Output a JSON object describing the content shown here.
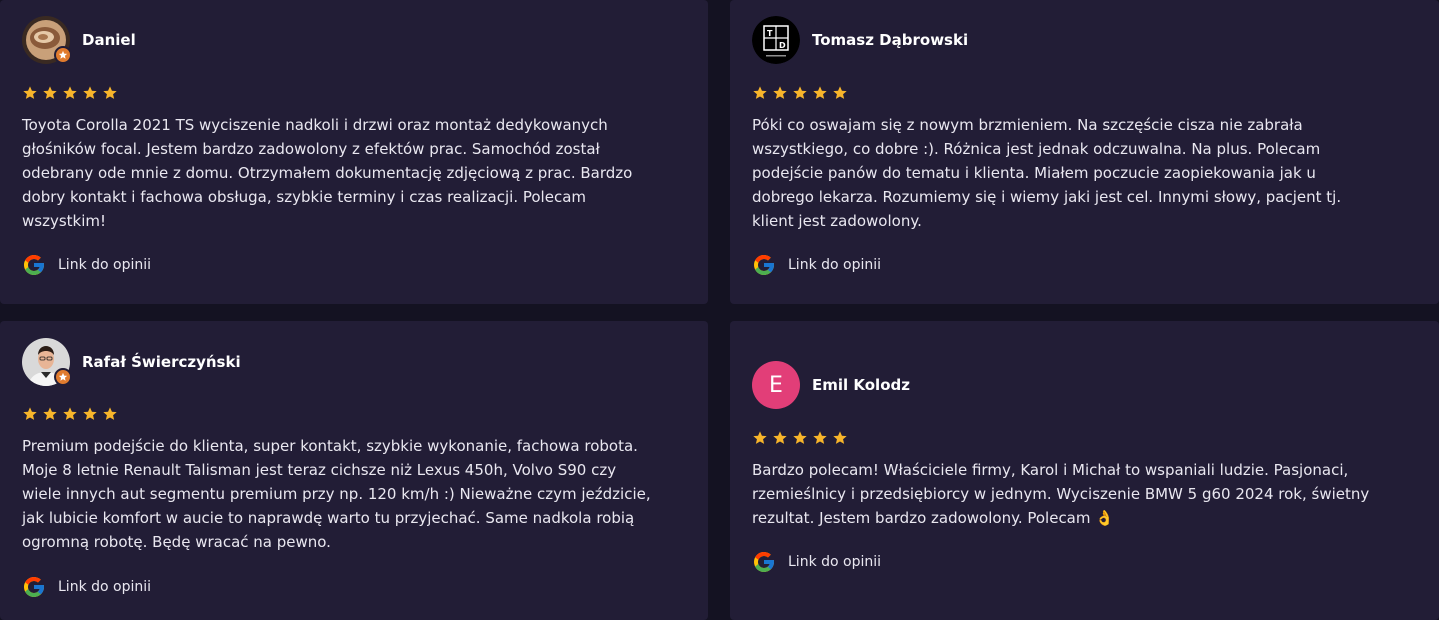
{
  "colors": {
    "page_background": "#141222",
    "card_background": "#221d36",
    "star": "#f7b52b",
    "text": "#e9e7f0",
    "letter_avatar": "#e23e78",
    "local_guide_badge": "#e07b2e"
  },
  "reviews": [
    {
      "author": "Daniel",
      "avatar_icon": "daniel-photo-avatar",
      "local_guide_badge": true,
      "rating": 5,
      "text": "Toyota Corolla 2021 TS wyciszenie nadkoli i drzwi oraz montaż dedykowanych\ngłośników focal. Jestem bardzo zadowolony z efektów prac. Samochód został\nodebrany ode mnie z domu. Otrzymałem dokumentację zdjęciową z prac. Bardzo\ndobry kontakt i fachowa obsługa, szybkie terminy i czas realizacji. Polecam\nwszystkim!",
      "link_label": "Link do opinii",
      "link_icon": "google-g-icon"
    },
    {
      "author": "Tomasz Dąbrowski",
      "avatar_icon": "td-logo-avatar",
      "local_guide_badge": false,
      "rating": 5,
      "text": "Póki co oswajam się z nowym brzmieniem. Na szczęście cisza nie zabrała\nwszystkiego, co dobre :). Różnica jest jednak odczuwalna. Na plus. Polecam\npodejście panów do tematu i klienta. Miałem poczucie zaopiekowania jak u\ndobrego lekarza. Rozumiemy się i wiemy jaki jest cel. Innymi słowy, pacjent tj.\nklient jest zadowolony.",
      "link_label": "Link do opinii",
      "link_icon": "google-g-icon"
    },
    {
      "author": "Rafał Świerczyński",
      "avatar_icon": "rafal-photo-avatar",
      "local_guide_badge": true,
      "rating": 5,
      "text": "Premium podejście do klienta, super kontakt, szybkie wykonanie, fachowa robota.\nMoje 8 letnie Renault Talisman jest teraz cichsze niż Lexus 450h, Volvo S90 czy\nwiele innych aut segmentu premium przy np. 120 km/h :) Nieważne czym jeździcie,\njak lubicie komfort w aucie to naprawdę warto tu przyjechać. Same nadkola robią\nogromną robotę. Będę wracać na pewno.",
      "link_label": "Link do opinii",
      "link_icon": "google-g-icon"
    },
    {
      "author": "Emil Kolodz",
      "avatar_letter": "E",
      "avatar_icon": "letter-avatar",
      "local_guide_badge": false,
      "rating": 5,
      "text": "Bardzo polecam! Właściciele firmy, Karol i Michał to wspaniali ludzie. Pasjonaci,\nrzemieślnicy i przedsiębiorcy w jednym. Wyciszenie BMW 5 g60 2024 rok, świetny\nrezultat. Jestem bardzo zadowolony. Polecam 👌",
      "link_label": "Link do opinii",
      "link_icon": "google-g-icon"
    }
  ]
}
